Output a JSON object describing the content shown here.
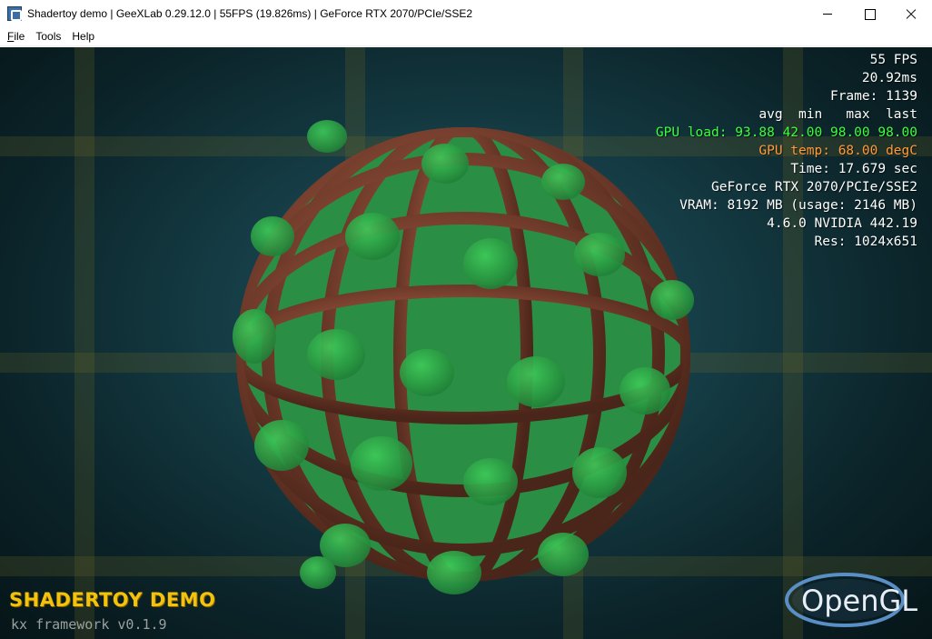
{
  "window": {
    "title": "Shadertoy demo | GeeXLab 0.29.12.0 | 55FPS (19.826ms) | GeForce RTX 2070/PCIe/SSE2",
    "app_icon": "geexlab-icon",
    "controls": [
      "minimize-icon",
      "maximize-icon",
      "close-icon"
    ]
  },
  "menu": {
    "items": [
      {
        "accel": "F",
        "rest": "ile"
      },
      {
        "accel": "",
        "rest": "Tools"
      },
      {
        "accel": "",
        "rest": "Help"
      }
    ]
  },
  "hud": {
    "fps": "55 FPS",
    "frame_time": "20.92ms",
    "frame": "Frame: 1139",
    "stats_header": "avg  min   max  last",
    "gpu_load": "GPU load: 93.88 42.00 98.00 98.00",
    "gpu_temp": "GPU temp: 68.00 degC",
    "time": "Time: 17.679 sec",
    "gpu_name": "GeForce RTX 2070/PCIe/SSE2",
    "vram": "VRAM: 8192 MB (usage: 2146 MB)",
    "driver": "4.6.0 NVIDIA 442.19",
    "resolution": "Res: 1024x651"
  },
  "overlay": {
    "demo_title": "SHADERTOY DEMO",
    "framework": "kx framework v0.1.9",
    "logo_text": "OpenGL"
  },
  "colors": {
    "hud_text": "#ffffff",
    "gpu_load": "#3dff3d",
    "gpu_temp": "#ff9a3c",
    "demo_title": "#f2c20c",
    "cage": "#8a4a35",
    "blobs": "#2fa04a",
    "background": "#163e47"
  }
}
